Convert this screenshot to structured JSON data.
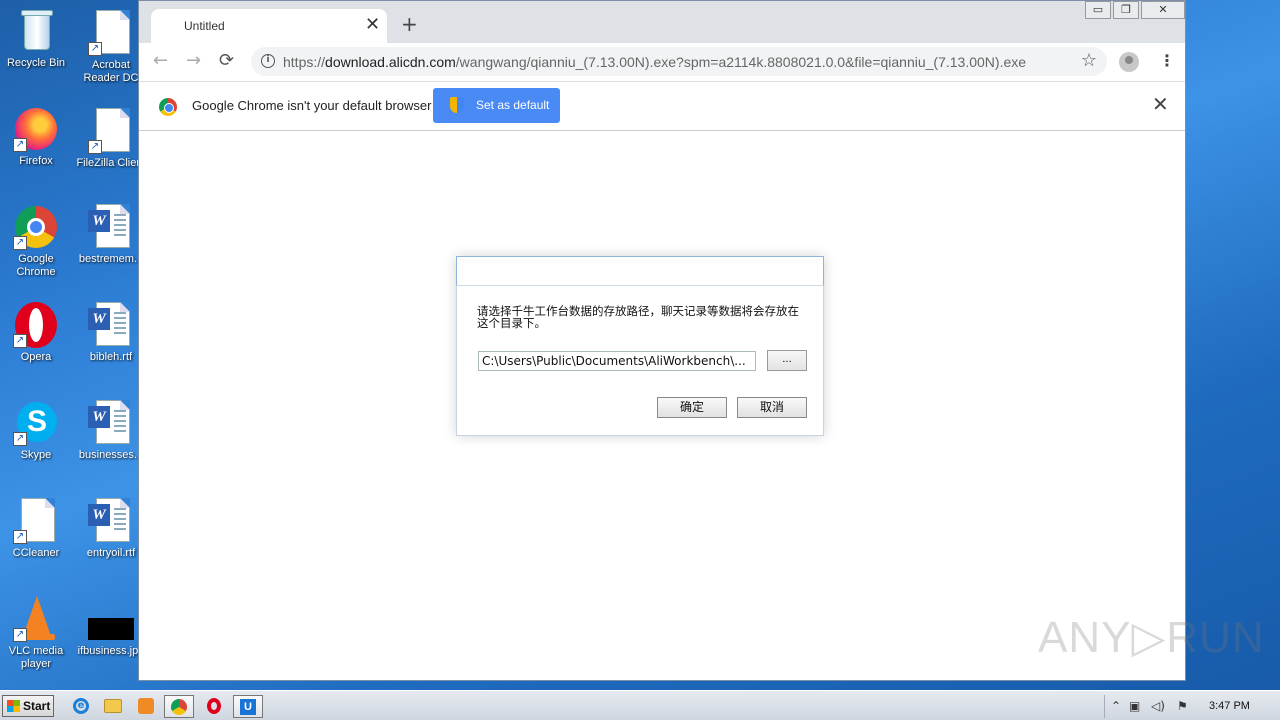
{
  "desktop": {
    "icons": [
      {
        "label": "Recycle Bin",
        "icon": "recycle-bin-icon"
      },
      {
        "label": "Acrobat Reader DC",
        "icon": "file-icon"
      },
      {
        "label": "Firefox",
        "icon": "firefox-icon"
      },
      {
        "label": "FileZilla Client",
        "icon": "file-icon"
      },
      {
        "label": "Google Chrome",
        "icon": "chrome-icon"
      },
      {
        "label": "bestremem...",
        "icon": "word-doc-icon"
      },
      {
        "label": "Opera",
        "icon": "opera-icon"
      },
      {
        "label": "bibleh.rtf",
        "icon": "word-doc-icon"
      },
      {
        "label": "Skype",
        "icon": "skype-icon"
      },
      {
        "label": "businesses...",
        "icon": "word-doc-icon"
      },
      {
        "label": "CCleaner",
        "icon": "file-icon"
      },
      {
        "label": "entryoil.rtf",
        "icon": "word-doc-icon"
      },
      {
        "label": "VLC media player",
        "icon": "vlc-icon"
      },
      {
        "label": "ifbusiness.jpg",
        "icon": "image-file-icon"
      }
    ]
  },
  "browser": {
    "tab_title": "Untitled",
    "tab_close": "✕",
    "new_tab": "+",
    "url_prefix": "https://",
    "url_host": "download.alicdn.com",
    "url_path": "/wangwang/qianniu_(7.13.00N).exe?spm=a2114k.8808021.0.0&file=qianniu_(7.13.00N).exe",
    "window_buttons": {
      "minimize": "▭",
      "restore": "❐",
      "close": "✕"
    },
    "nav": {
      "back": "←",
      "forward": "→",
      "reload": "⟳",
      "star": "☆",
      "menu": "⋮"
    }
  },
  "infobar": {
    "message": "Google Chrome isn't your default browser",
    "button_label": "Set as default",
    "close": "✕"
  },
  "dialog": {
    "title": "",
    "message": "请选择千牛工作台数据的存放路径，聊天记录等数据将会存放在这个目录下。",
    "path_value": "C:\\Users\\Public\\Documents\\AliWorkbench\\...",
    "browse_label": "...",
    "ok_label": "确定",
    "cancel_label": "取消"
  },
  "watermark": "ANY▷RUN",
  "taskbar": {
    "start_label": "Start",
    "clock": "3:47 PM"
  },
  "colors": {
    "accent": "#4a8af4",
    "desktop_bg": "#2a7ad1"
  }
}
